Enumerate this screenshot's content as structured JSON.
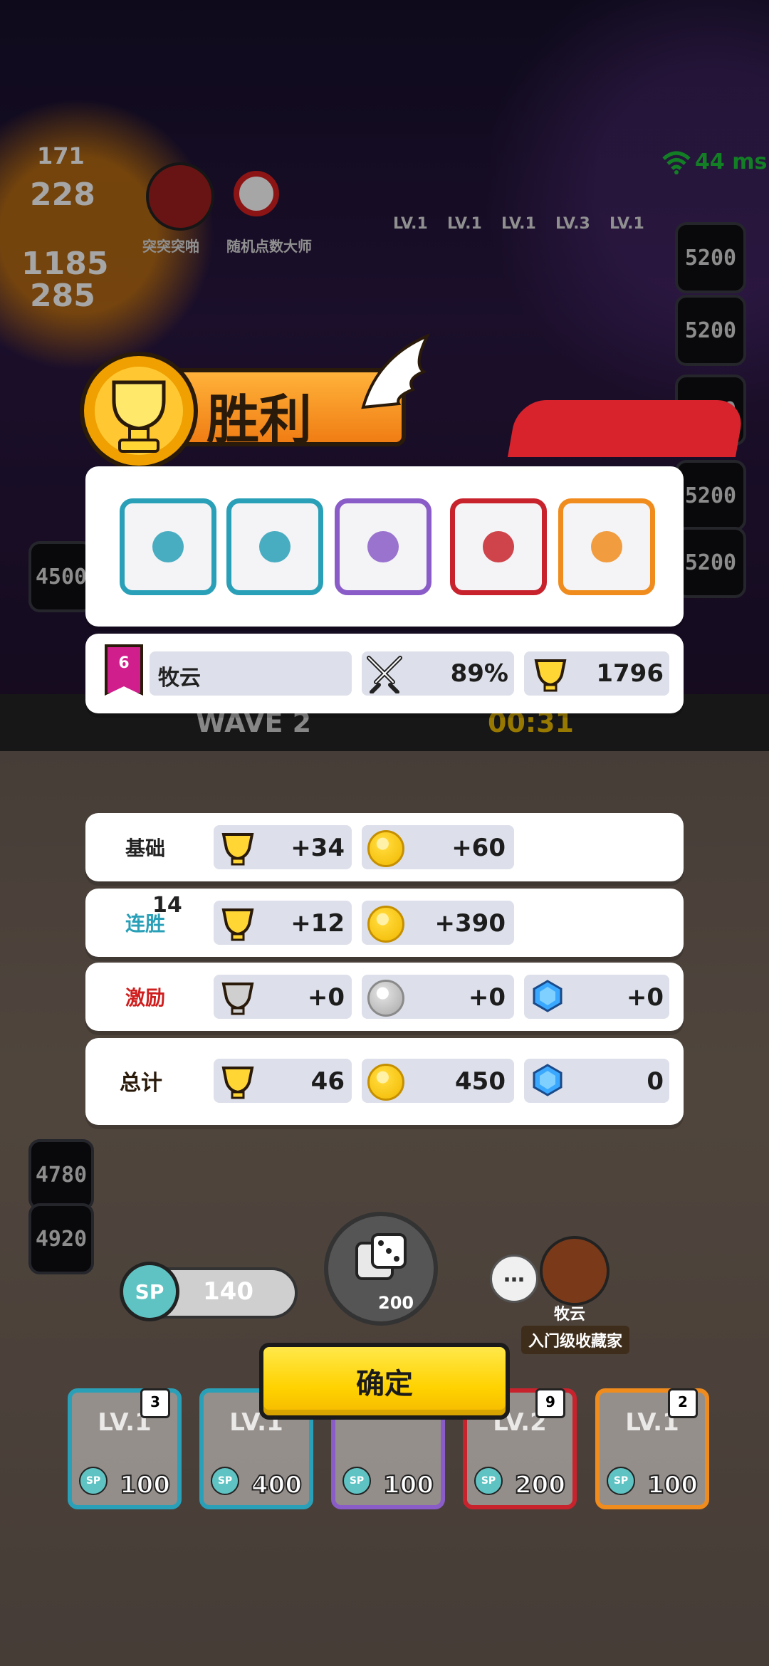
{
  "hud": {
    "ping": "44 ms",
    "left_scores": [
      "171",
      "228",
      "1185",
      "285"
    ],
    "player_labels": [
      "突突突啪",
      "随机点数大师"
    ],
    "lv_labels": [
      "LV.1",
      "LV.1",
      "LV.1",
      "LV.3",
      "LV.1"
    ],
    "right_values": [
      "5200",
      "5200",
      "5200",
      "5200",
      "5200",
      "5200"
    ],
    "left_values": [
      "4500",
      "4780",
      "4920"
    ],
    "wave_label": "WAVE 2",
    "timer": "00:31"
  },
  "victory": {
    "title": "胜利"
  },
  "deck": {
    "dice": [
      {
        "name": "blue-vortex",
        "color": "#2aa0b8"
      },
      {
        "name": "cyan-vortex",
        "color": "#2aa0b8"
      },
      {
        "name": "purple-vortex",
        "color": "#8a5cc8"
      },
      {
        "name": "red-crack",
        "color": "#c8232d"
      },
      {
        "name": "orange-target",
        "color": "#f08c1e"
      }
    ]
  },
  "player": {
    "rank_badge": "6",
    "name": "牧云",
    "win_rate": "89%",
    "trophies": "1796"
  },
  "rewards": [
    {
      "label": "基础",
      "trophy": "+34",
      "coin": "+60",
      "gem": ""
    },
    {
      "label": "连胜",
      "label_num": "14",
      "trophy": "+12",
      "coin": "+390",
      "gem": ""
    },
    {
      "label": "激励",
      "trophy": "+0",
      "coin": "+0",
      "gem": "+0"
    }
  ],
  "total": {
    "label": "总计",
    "trophy": "46",
    "coin": "450",
    "gem": "0"
  },
  "bottom": {
    "sp_label": "SP",
    "sp_value": "140",
    "roll_cost": "200",
    "opponent_name": "牧云",
    "opponent_title": "入门级收藏家",
    "confirm_label": "确定",
    "cards": [
      {
        "lv": "LV.1",
        "cost": "100",
        "badge": "3",
        "color": "#2aa0b8"
      },
      {
        "lv": "LV.1",
        "cost": "400",
        "badge": "",
        "color": "#2aa0b8"
      },
      {
        "lv": "",
        "cost": "100",
        "badge": "",
        "color": "#8a5cc8"
      },
      {
        "lv": "LV.2",
        "cost": "200",
        "badge": "9",
        "color": "#c8232d"
      },
      {
        "lv": "LV.1",
        "cost": "100",
        "badge": "2",
        "color": "#f08c1e"
      }
    ]
  }
}
